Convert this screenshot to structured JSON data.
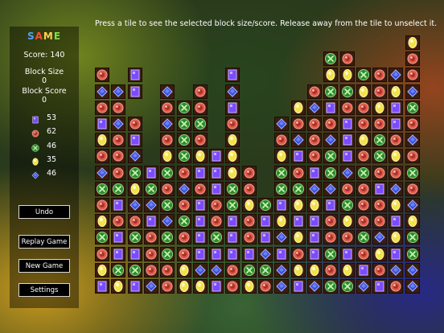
{
  "instruction": "Press a tile to see the selected block size/score. Release away from the tile to unselect it.",
  "logo": {
    "letters": [
      "S",
      "A",
      "M",
      "E"
    ]
  },
  "score_text": "Score: 140",
  "block_size_label": "Block Size",
  "block_size_value": "0",
  "block_score_label": "Block Score",
  "block_score_value": "0",
  "legend": [
    {
      "icon": "purple-square",
      "count": "53"
    },
    {
      "icon": "red-circle",
      "count": "62"
    },
    {
      "icon": "green-x",
      "count": "46"
    },
    {
      "icon": "yellow-oval",
      "count": "35"
    },
    {
      "icon": "blue-diamond",
      "count": "46"
    }
  ],
  "buttons": {
    "undo": "Undo",
    "replay": "Replay Game",
    "new_game": "New Game",
    "settings": "Settings"
  },
  "colors": {
    "purple-square": "#7a4bff",
    "red-circle": "#e05a4a",
    "green-x": "#2c8a2a",
    "yellow-oval": "#f2e24a",
    "blue-diamond": "#3a4fd8"
  },
  "board": {
    "columns": 20,
    "rows": 16,
    "codes": {
      "P": "purple-square",
      "R": "red-circle",
      "G": "green-x",
      "Y": "yellow-oval",
      "B": "blue-diamond",
      ".": "empty"
    },
    "grid": [
      "...................Y",
      "..............GR...R",
      "R.P.....P.....YYGRBR",
      "BBP.B.R.B....RGGYRYB",
      "RR..RGR.P...YBPRRYPG",
      "PBR.BGG.R..BRRRPRRPR",
      "YRP.RGR.Y..RBRBPYGRB",
      "RRB.YGYPY..YPRGPRGYR",
      "BRGPGRPPYR.GRPGBGRRG",
      "GGYGRBRPGR.GGBBRRPBR",
      "RPBBGRPRGYGPYYPGRRYB",
      "YRRPBGPRPRPYPPRYRRPY",
      "GPGRGRPGPRPBYPRRGBYG",
      "RPPRGRPPPPBPRPGPRYPG",
      "YGGRRYBBRGGBYYRYPRBB",
      "PYPBRYYPRYRBPBGGBPRB"
    ]
  }
}
